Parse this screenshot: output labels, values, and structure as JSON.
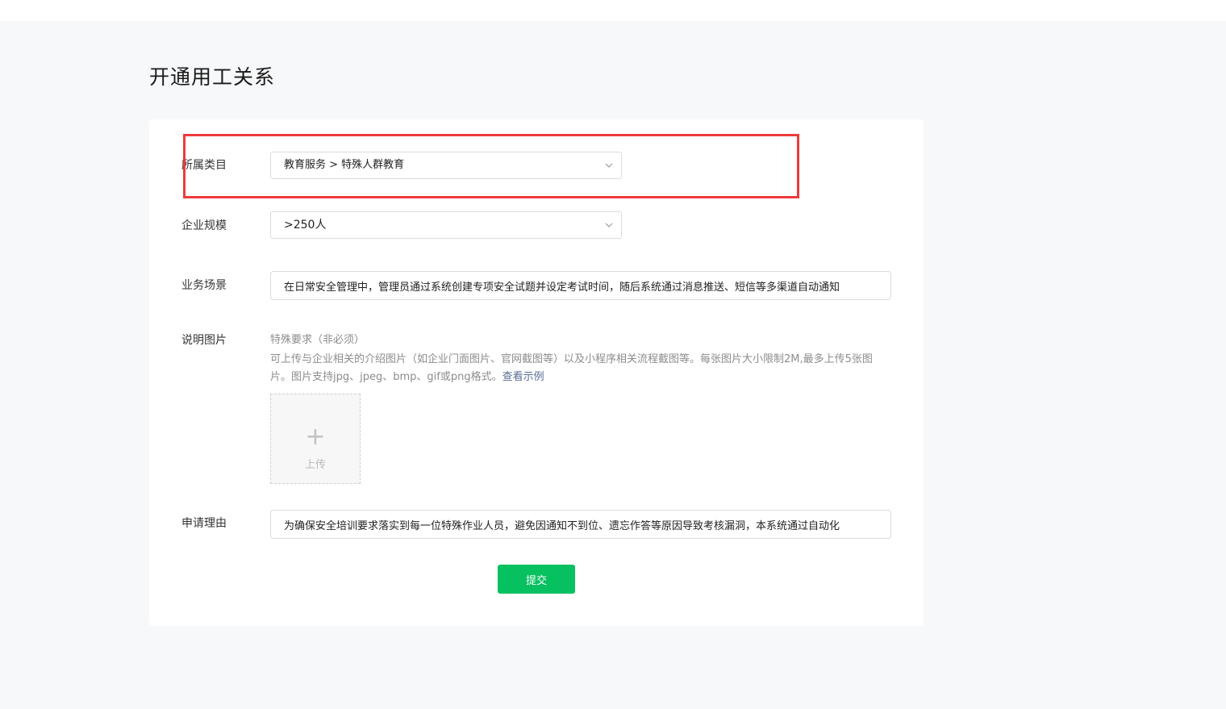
{
  "page": {
    "title": "开通用工关系"
  },
  "form": {
    "category": {
      "label": "所属类目",
      "value": "教育服务 > 特殊人群教育"
    },
    "company_size": {
      "label": "企业规模",
      "value": ">250人"
    },
    "business_scenario": {
      "label": "业务场景",
      "value": "在日常安全管理中，管理员通过系统创建专项安全试题并设定考试时间，随后系统通过消息推送、短信等多渠道自动通知"
    },
    "images": {
      "label": "说明图片",
      "hint_title": "特殊要求（非必须）",
      "hint_body": "可上传与企业相关的介绍图片（如企业门面图片、官网截图等）以及小程序相关流程截图等。每张图片大小限制2M,最多上传5张图片。图片支持jpg、jpeg、bmp、gif或png格式。",
      "hint_link": "查看示例",
      "upload_label": "上传"
    },
    "reason": {
      "label": "申请理由",
      "value": "为确保安全培训要求落实到每一位特殊作业人员，避免因通知不到位、遗忘作答等原因导致考核漏洞，本系统通过自动化"
    },
    "submit_label": "提交"
  },
  "colors": {
    "accent": "#07c160",
    "link": "#576b95",
    "highlight": "#ee3b3b",
    "page_bg": "#f7f8fa"
  }
}
